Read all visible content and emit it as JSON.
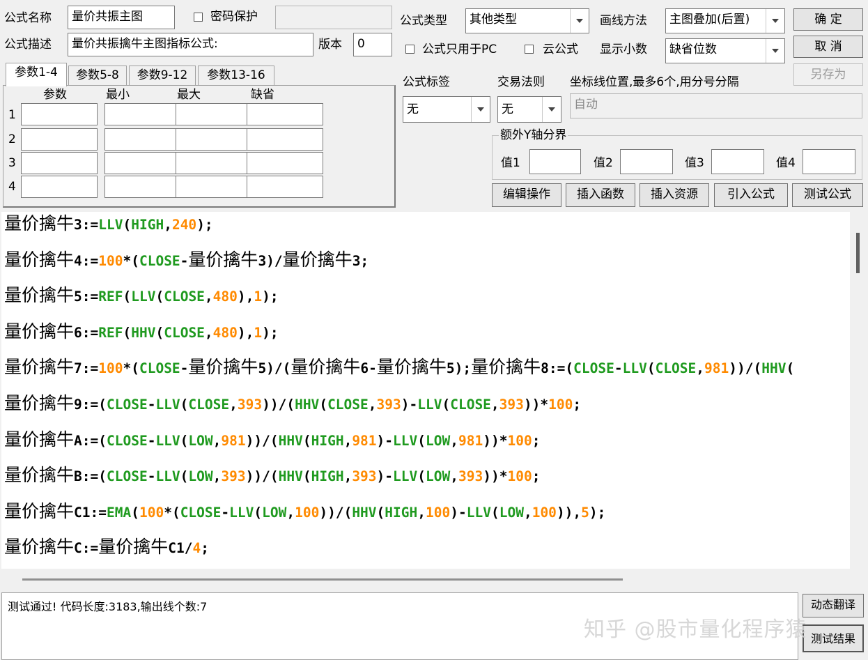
{
  "header": {
    "name_label": "公式名称",
    "name_value": "量价共振主图",
    "password_label": "密码保护",
    "desc_label": "公式描述",
    "desc_value": "量价共振擒牛主图指标公式:",
    "version_label": "版本",
    "version_value": "0",
    "type_label": "公式类型",
    "type_value": "其他类型",
    "draw_label": "画线方法",
    "draw_value": "主图叠加(后置)",
    "pc_only_label": "公式只用于PC",
    "cloud_label": "云公式",
    "decimals_label": "显示小数",
    "decimals_value": "缺省位数",
    "ok_button": "确 定",
    "cancel_button": "取 消",
    "save_as_button": "另存为",
    "tag_label": "公式标签",
    "tag_value": "无",
    "rule_label": "交易法则",
    "rule_value": "无",
    "axis_label": "坐标线位置,最多6个,用分号分隔",
    "axis_placeholder": "自动",
    "extra_y_label": "额外Y轴分界",
    "val_labels": [
      "值1",
      "值2",
      "值3",
      "值4"
    ]
  },
  "tabs": [
    "参数1-4",
    "参数5-8",
    "参数9-12",
    "参数13-16"
  ],
  "params": {
    "headers": [
      "参数",
      "最小",
      "最大",
      "缺省"
    ],
    "rows": [
      "1",
      "2",
      "3",
      "4"
    ]
  },
  "toolbar": {
    "edit": "编辑操作",
    "insert_func": "插入函数",
    "insert_res": "插入资源",
    "import": "引入公式",
    "test": "测试公式"
  },
  "code": [
    [
      [
        "cn",
        "量价擒牛"
      ],
      [
        "t",
        "3:="
      ],
      [
        "f",
        "LLV"
      ],
      [
        "t",
        "("
      ],
      [
        "f",
        "HIGH"
      ],
      [
        "t",
        ","
      ],
      [
        "n",
        "240"
      ],
      [
        "t",
        ");"
      ]
    ],
    [
      [
        "cn",
        "量价擒牛"
      ],
      [
        "t",
        "4:="
      ],
      [
        "n",
        "100"
      ],
      [
        "t",
        "*("
      ],
      [
        "f",
        "CLOSE"
      ],
      [
        "t",
        "-"
      ],
      [
        "cn",
        "量价擒牛"
      ],
      [
        "t",
        "3)/"
      ],
      [
        "cn",
        "量价擒牛"
      ],
      [
        "t",
        "3;"
      ]
    ],
    [
      [
        "cn",
        "量价擒牛"
      ],
      [
        "t",
        "5:="
      ],
      [
        "f",
        "REF"
      ],
      [
        "t",
        "("
      ],
      [
        "f",
        "LLV"
      ],
      [
        "t",
        "("
      ],
      [
        "f",
        "CLOSE"
      ],
      [
        "t",
        ","
      ],
      [
        "n",
        "480"
      ],
      [
        "t",
        "),"
      ],
      [
        "n",
        "1"
      ],
      [
        "t",
        ");"
      ]
    ],
    [
      [
        "cn",
        "量价擒牛"
      ],
      [
        "t",
        "6:="
      ],
      [
        "f",
        "REF"
      ],
      [
        "t",
        "("
      ],
      [
        "f",
        "HHV"
      ],
      [
        "t",
        "("
      ],
      [
        "f",
        "CLOSE"
      ],
      [
        "t",
        ","
      ],
      [
        "n",
        "480"
      ],
      [
        "t",
        "),"
      ],
      [
        "n",
        "1"
      ],
      [
        "t",
        ");"
      ]
    ],
    [
      [
        "cn",
        "量价擒牛"
      ],
      [
        "t",
        "7:="
      ],
      [
        "n",
        "100"
      ],
      [
        "t",
        "*("
      ],
      [
        "f",
        "CLOSE"
      ],
      [
        "t",
        "-"
      ],
      [
        "cn",
        "量价擒牛"
      ],
      [
        "t",
        "5)/("
      ],
      [
        "cn",
        "量价擒牛"
      ],
      [
        "t",
        "6-"
      ],
      [
        "cn",
        "量价擒牛"
      ],
      [
        "t",
        "5);"
      ],
      [
        "cn",
        "量价擒牛"
      ],
      [
        "t",
        "8:=("
      ],
      [
        "f",
        "CLOSE"
      ],
      [
        "t",
        "-"
      ],
      [
        "f",
        "LLV"
      ],
      [
        "t",
        "("
      ],
      [
        "f",
        "CLOSE"
      ],
      [
        "t",
        ","
      ],
      [
        "n",
        "981"
      ],
      [
        "t",
        "))/("
      ],
      [
        "f",
        "HHV"
      ],
      [
        "t",
        "("
      ]
    ],
    [
      [
        "cn",
        "量价擒牛"
      ],
      [
        "t",
        "9:=("
      ],
      [
        "f",
        "CLOSE"
      ],
      [
        "t",
        "-"
      ],
      [
        "f",
        "LLV"
      ],
      [
        "t",
        "("
      ],
      [
        "f",
        "CLOSE"
      ],
      [
        "t",
        ","
      ],
      [
        "n",
        "393"
      ],
      [
        "t",
        "))/("
      ],
      [
        "f",
        "HHV"
      ],
      [
        "t",
        "("
      ],
      [
        "f",
        "CLOSE"
      ],
      [
        "t",
        ","
      ],
      [
        "n",
        "393"
      ],
      [
        "t",
        ")-"
      ],
      [
        "f",
        "LLV"
      ],
      [
        "t",
        "("
      ],
      [
        "f",
        "CLOSE"
      ],
      [
        "t",
        ","
      ],
      [
        "n",
        "393"
      ],
      [
        "t",
        "))*"
      ],
      [
        "n",
        "100"
      ],
      [
        "t",
        ";"
      ]
    ],
    [
      [
        "cn",
        "量价擒牛"
      ],
      [
        "t",
        "A:=("
      ],
      [
        "f",
        "CLOSE"
      ],
      [
        "t",
        "-"
      ],
      [
        "f",
        "LLV"
      ],
      [
        "t",
        "("
      ],
      [
        "f",
        "LOW"
      ],
      [
        "t",
        ","
      ],
      [
        "n",
        "981"
      ],
      [
        "t",
        "))/("
      ],
      [
        "f",
        "HHV"
      ],
      [
        "t",
        "("
      ],
      [
        "f",
        "HIGH"
      ],
      [
        "t",
        ","
      ],
      [
        "n",
        "981"
      ],
      [
        "t",
        ")-"
      ],
      [
        "f",
        "LLV"
      ],
      [
        "t",
        "("
      ],
      [
        "f",
        "LOW"
      ],
      [
        "t",
        ","
      ],
      [
        "n",
        "981"
      ],
      [
        "t",
        "))*"
      ],
      [
        "n",
        "100"
      ],
      [
        "t",
        ";"
      ]
    ],
    [
      [
        "cn",
        "量价擒牛"
      ],
      [
        "t",
        "B:=("
      ],
      [
        "f",
        "CLOSE"
      ],
      [
        "t",
        "-"
      ],
      [
        "f",
        "LLV"
      ],
      [
        "t",
        "("
      ],
      [
        "f",
        "LOW"
      ],
      [
        "t",
        ","
      ],
      [
        "n",
        "393"
      ],
      [
        "t",
        "))/("
      ],
      [
        "f",
        "HHV"
      ],
      [
        "t",
        "("
      ],
      [
        "f",
        "HIGH"
      ],
      [
        "t",
        ","
      ],
      [
        "n",
        "393"
      ],
      [
        "t",
        ")-"
      ],
      [
        "f",
        "LLV"
      ],
      [
        "t",
        "("
      ],
      [
        "f",
        "LOW"
      ],
      [
        "t",
        ","
      ],
      [
        "n",
        "393"
      ],
      [
        "t",
        "))*"
      ],
      [
        "n",
        "100"
      ],
      [
        "t",
        ";"
      ]
    ],
    [
      [
        "cn",
        "量价擒牛"
      ],
      [
        "t",
        "C1:="
      ],
      [
        "f",
        "EMA"
      ],
      [
        "t",
        "("
      ],
      [
        "n",
        "100"
      ],
      [
        "t",
        "*("
      ],
      [
        "f",
        "CLOSE"
      ],
      [
        "t",
        "-"
      ],
      [
        "f",
        "LLV"
      ],
      [
        "t",
        "("
      ],
      [
        "f",
        "LOW"
      ],
      [
        "t",
        ","
      ],
      [
        "n",
        "100"
      ],
      [
        "t",
        "))/("
      ],
      [
        "f",
        "HHV"
      ],
      [
        "t",
        "("
      ],
      [
        "f",
        "HIGH"
      ],
      [
        "t",
        ","
      ],
      [
        "n",
        "100"
      ],
      [
        "t",
        ")-"
      ],
      [
        "f",
        "LLV"
      ],
      [
        "t",
        "("
      ],
      [
        "f",
        "LOW"
      ],
      [
        "t",
        ","
      ],
      [
        "n",
        "100"
      ],
      [
        "t",
        ")),"
      ],
      [
        "n",
        "5"
      ],
      [
        "t",
        ");"
      ]
    ],
    [
      [
        "cn",
        "量价擒牛"
      ],
      [
        "t",
        "C:="
      ],
      [
        "cn",
        "量价擒牛"
      ],
      [
        "t",
        "C1/"
      ],
      [
        "n",
        "4"
      ],
      [
        "t",
        ";"
      ]
    ]
  ],
  "result_text": "测试通过! 代码长度:3183,输出线个数:7",
  "side_buttons": {
    "translate": "动态翻译",
    "test_result": "测试结果"
  },
  "watermark": "知乎 @股市量化程序猿",
  "colors": {
    "function": "#1f9a1f",
    "number": "#ff8a00",
    "text": "#000000"
  }
}
